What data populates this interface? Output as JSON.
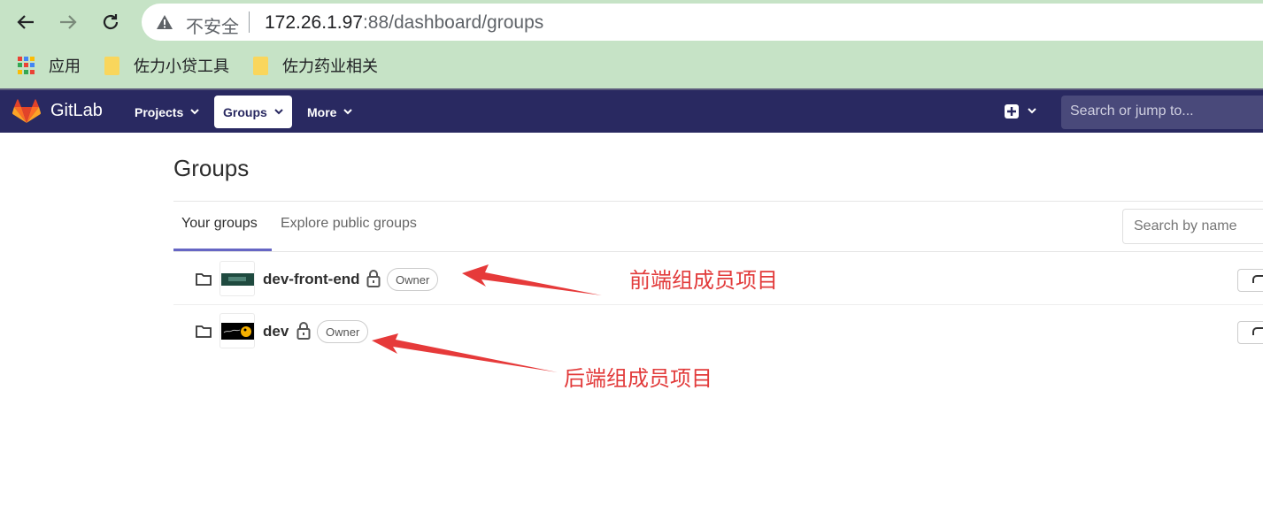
{
  "browser": {
    "back_icon": "arrow-left-icon",
    "forward_icon": "arrow-right-icon",
    "reload_icon": "reload-icon",
    "security_label": "不安全",
    "url_host": "172.26.1.97",
    "url_rest": ":88/dashboard/groups",
    "bookmarks": [
      {
        "label": "应用",
        "icon": "apps-grid-icon"
      },
      {
        "label": "佐力小贷工具",
        "icon": "folder-icon"
      },
      {
        "label": "佐力药业相关",
        "icon": "folder-icon"
      }
    ]
  },
  "gitlab": {
    "brand": "GitLab",
    "menu": [
      {
        "label": "Projects"
      },
      {
        "label": "Groups"
      },
      {
        "label": "More"
      }
    ],
    "search_placeholder": "Search or jump to...",
    "colors": {
      "header": "#292961",
      "accent": "#6666c4"
    }
  },
  "page": {
    "title": "Groups",
    "tabs": [
      {
        "label": "Your groups",
        "active": true
      },
      {
        "label": "Explore public groups",
        "active": false
      }
    ],
    "filter_placeholder": "Search by name",
    "groups": [
      {
        "name": "dev-front-end",
        "role": "Owner",
        "visibility": "private"
      },
      {
        "name": "dev",
        "role": "Owner",
        "visibility": "private"
      }
    ]
  },
  "annotations": [
    {
      "text": "前端组成员项目"
    },
    {
      "text": "后端组成员项目"
    }
  ]
}
